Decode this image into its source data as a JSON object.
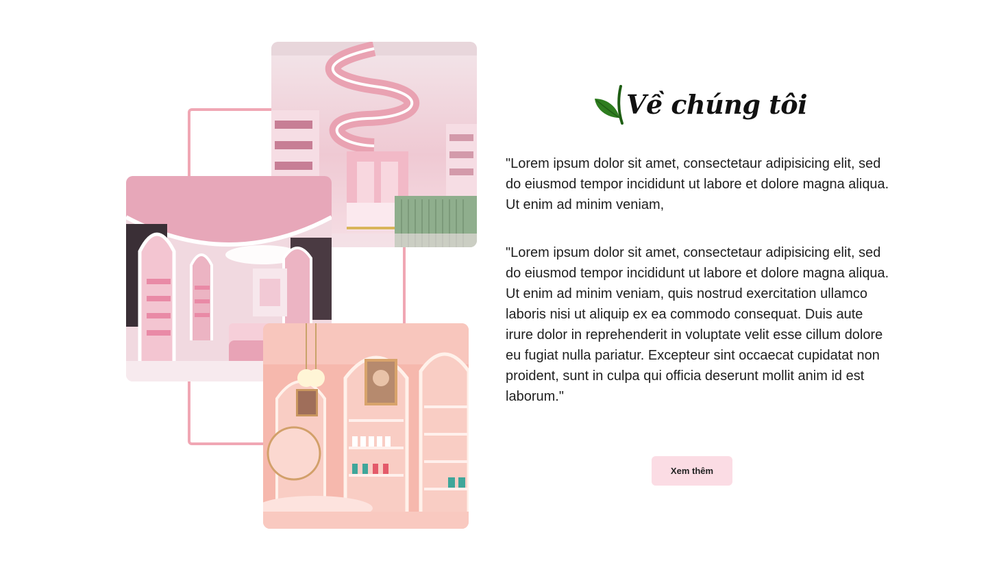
{
  "section": {
    "title": "Về chúng tôi",
    "title_icon": "leaf-icon",
    "paragraphs": [
      "\"Lorem ipsum dolor sit amet, consectetaur adipisicing elit, sed do eiusmod tempor incididunt ut labore et dolore magna aliqua. Ut enim ad minim veniam,",
      "\"Lorem ipsum dolor sit amet, consectetaur adipisicing elit, sed do eiusmod tempor incididunt ut labore et dolore magna aliqua. Ut enim ad minim veniam, quis nostrud exercitation ullamco laboris nisi ut aliquip ex ea commodo consequat. Duis aute irure dolor in reprehenderit in voluptate velit esse cillum dolore eu fugiat nulla pariatur. Excepteur sint occaecat cupidatat non proident, sunt in culpa qui officia deserunt mollit anim id est laborum.\""
    ],
    "button_label": "Xem thêm"
  },
  "collage": {
    "images": [
      {
        "name": "store-interior-ceiling-photo"
      },
      {
        "name": "store-interior-aisle-photo"
      },
      {
        "name": "store-interior-shelves-photo"
      }
    ],
    "frame_color": "#f0a7b4"
  },
  "colors": {
    "accent_pink": "#fbdce4",
    "leaf_green": "#2e7d1f",
    "text": "#1f1f1f"
  }
}
